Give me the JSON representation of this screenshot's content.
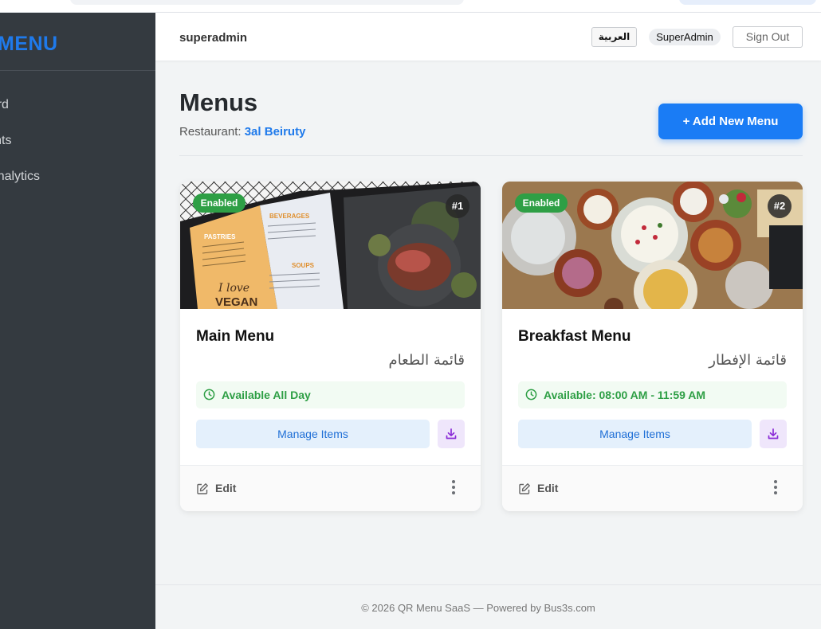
{
  "sidebar": {
    "brand": "MENU",
    "items": [
      {
        "label": "board"
      },
      {
        "label": "urants"
      },
      {
        "label": "al Analytics"
      }
    ]
  },
  "header": {
    "username": "superadmin",
    "language_button": "العربية",
    "role_badge": "SuperAdmin",
    "signout_label": "Sign Out"
  },
  "page": {
    "title": "Menus",
    "restaurant_prefix": "Restaurant:",
    "restaurant_name": "3al Beiruty",
    "add_button": "+ Add New Menu"
  },
  "cards": [
    {
      "status": "Enabled",
      "number": "#1",
      "name": "Main Menu",
      "name_ar": "قائمة الطعام",
      "availability": "Available All Day",
      "manage_label": "Manage Items",
      "edit_label": "Edit"
    },
    {
      "status": "Enabled",
      "number": "#2",
      "name": "Breakfast Menu",
      "name_ar": "قائمة الإفطار",
      "availability": "Available: 08:00 AM - 11:59 AM",
      "manage_label": "Manage Items",
      "edit_label": "Edit"
    }
  ],
  "menu_image_text": {
    "pastries": "PASTRIES",
    "beverages": "BEVERAGES",
    "soups": "SOUPS",
    "love": "I love",
    "vegan": "VEGAN"
  },
  "footer": {
    "text": "© 2026 QR Menu SaaS — Powered by Bus3s.com"
  },
  "colors": {
    "accent": "#1a7cf5",
    "sidebar_bg": "#343a40",
    "enabled_green": "#2e9f45",
    "page_bg": "#f2f4f5"
  }
}
